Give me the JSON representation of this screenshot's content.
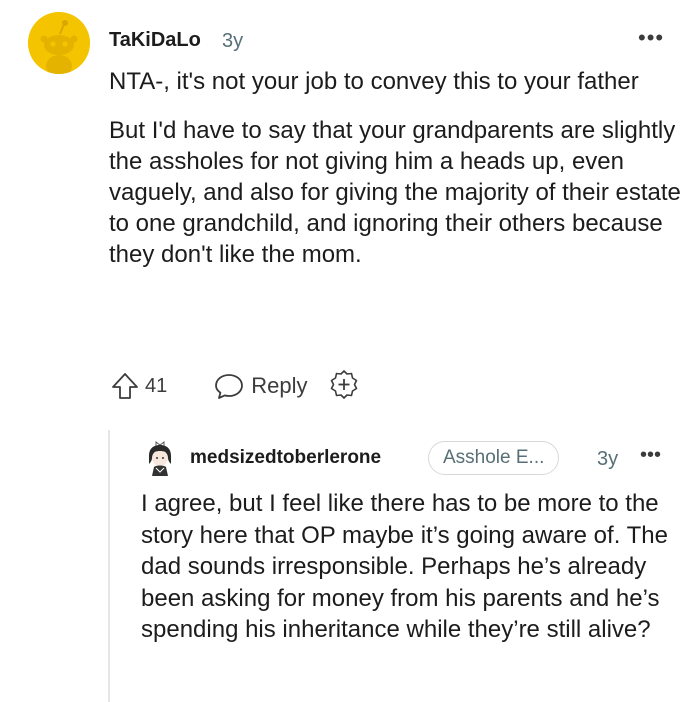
{
  "comment": {
    "author": "TaKiDaLo",
    "age": "3y",
    "paragraphs": [
      "NTA-, it's not your job to convey this to your father",
      "But I'd have to say that your grandparents are slightly the assholes for not giving him a heads up, even vaguely, and also for giving the majority of their estate to one grandchild, and ignoring their others because they don't like the mom."
    ],
    "votes": "41",
    "reply_label": "Reply",
    "more_label": "•••"
  },
  "reply": {
    "author": "medsizedtoberlerone",
    "flair": "Asshole E...",
    "age": "3y",
    "more_label": "•••",
    "text": "I agree, but I feel like there has to be more to the story here that OP maybe it’s going aware of. The dad sounds irresponsible. Perhaps he’s already been asking for money from his parents and he’s spending his inheritance while they’re still alive?"
  },
  "colors": {
    "avatar_bg": "#f5c400",
    "meta_text": "#576f76",
    "thread_line": "#e6e6e6"
  }
}
